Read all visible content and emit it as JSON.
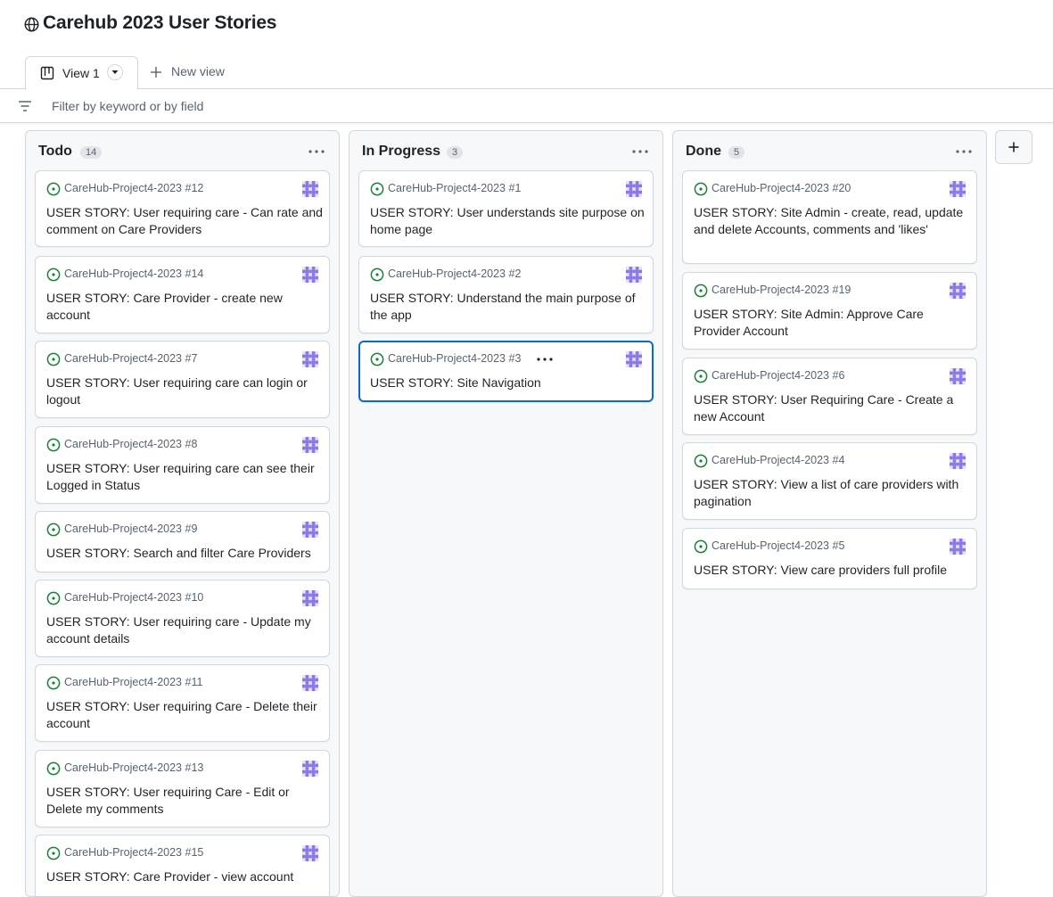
{
  "project": {
    "title": "Carehub 2023 User Stories",
    "visibility_icon": "globe-icon"
  },
  "tabs": {
    "active_label": "View 1",
    "new_view_label": "New view"
  },
  "filter": {
    "placeholder": "Filter by keyword or by field",
    "value": ""
  },
  "colors": {
    "accent": "#0969da",
    "open_issue": "#1a7f37",
    "avatar": "#8b78e6",
    "border": "#d0d7de",
    "column_bg": "#f6f8fa"
  },
  "columns": [
    {
      "name": "Todo",
      "count": "14",
      "cards": [
        {
          "repo": "CareHub-Project4-2023 #12",
          "title": "USER STORY: User requiring care - Can rate and comment on Care Providers"
        },
        {
          "repo": "CareHub-Project4-2023 #14",
          "title": "USER STORY: Care Provider - create new account"
        },
        {
          "repo": "CareHub-Project4-2023 #7",
          "title": "USER STORY: User requiring care can login or logout"
        },
        {
          "repo": "CareHub-Project4-2023 #8",
          "title": "USER STORY: User requiring care can see their Logged in Status"
        },
        {
          "repo": "CareHub-Project4-2023 #9",
          "title": "USER STORY: Search and filter Care Providers"
        },
        {
          "repo": "CareHub-Project4-2023 #10",
          "title": "USER STORY: User requiring care - Update my account details"
        },
        {
          "repo": "CareHub-Project4-2023 #11",
          "title": "USER STORY: User requiring Care - Delete their account"
        },
        {
          "repo": "CareHub-Project4-2023 #13",
          "title": "USER STORY: User requiring Care - Edit or Delete my comments"
        },
        {
          "repo": "CareHub-Project4-2023 #15",
          "title": "USER STORY: Care Provider - view account"
        }
      ]
    },
    {
      "name": "In Progress",
      "count": "3",
      "cards": [
        {
          "repo": "CareHub-Project4-2023 #1",
          "title": "USER STORY: User understands site purpose on home page"
        },
        {
          "repo": "CareHub-Project4-2023 #2",
          "title": "USER STORY: Understand the main purpose of the app"
        },
        {
          "repo": "CareHub-Project4-2023 #3",
          "title": "USER STORY: Site Navigation",
          "selected": true
        }
      ]
    },
    {
      "name": "Done",
      "count": "5",
      "cards": [
        {
          "repo": "CareHub-Project4-2023 #20",
          "title": "USER STORY: Site Admin - create, read, update and delete Accounts, comments and 'likes'"
        },
        {
          "repo": "CareHub-Project4-2023 #19",
          "title": "USER STORY: Site Admin: Approve Care Provider Account"
        },
        {
          "repo": "CareHub-Project4-2023 #6",
          "title": "USER STORY: User Requiring Care - Create a new Account"
        },
        {
          "repo": "CareHub-Project4-2023 #4",
          "title": "USER STORY: View a list of care providers with pagination"
        },
        {
          "repo": "CareHub-Project4-2023 #5",
          "title": "USER STORY: View care providers full profile"
        }
      ]
    }
  ]
}
